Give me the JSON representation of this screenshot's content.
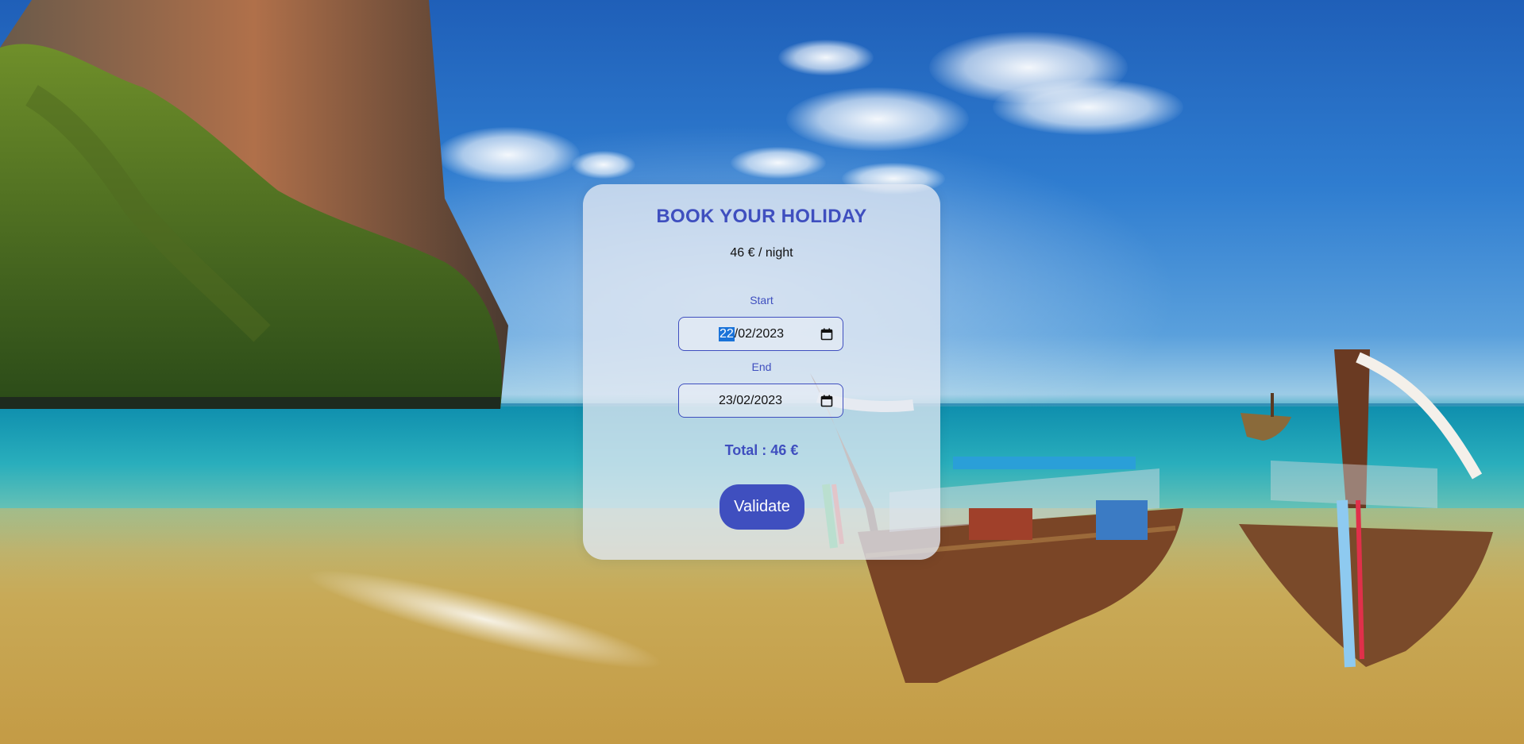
{
  "booking": {
    "title": "BOOK YOUR HOLIDAY",
    "price_per_night": "46 € / night",
    "start": {
      "label": "Start",
      "day": "22",
      "rest": "/02/2023"
    },
    "end": {
      "label": "End",
      "value": "23/02/2023"
    },
    "total": "Total : 46 €",
    "validate_label": "Validate"
  },
  "icons": {
    "date_picker": "calendar-icon"
  },
  "colors": {
    "accent": "#3f4fbf",
    "selection": "#1a73d9",
    "card_bg": "#e2e8f2"
  }
}
